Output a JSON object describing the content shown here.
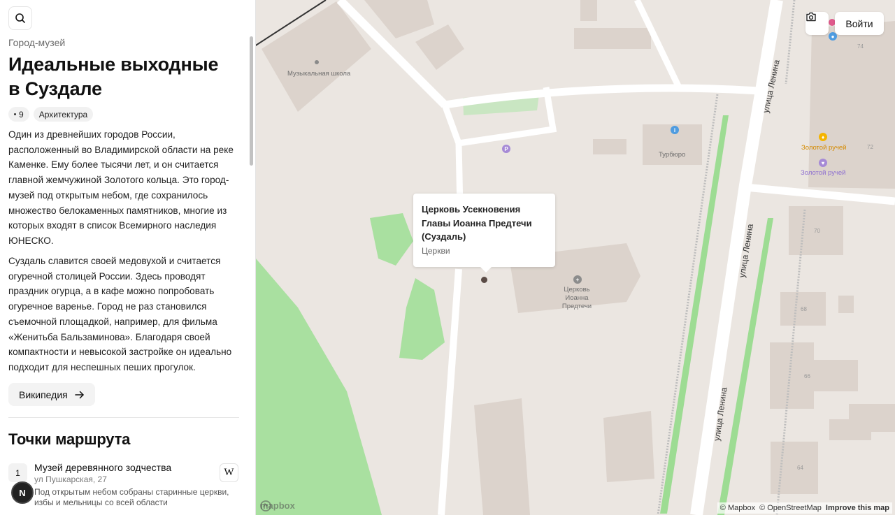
{
  "sidebar": {
    "eyebrow": "Город-музей",
    "title": "Идеальные выходные в Суздале",
    "chips": {
      "count": "9",
      "category": "Архитектура"
    },
    "paragraphs": [
      "Один из древнейших городов России, расположенный во Владимирской области на реке Каменке. Ему более тысячи лет, и он считается главной жемчужиной Золотого кольца. Это город-музей под открытым небом, где сохранилось множество белокаменных памятников, многие из которых входят в список Всемирного наследия ЮНЕСКО.",
      "Суздаль славится своей медовухой и считается огуречной столицей России. Здесь проводят праздник огурца, а в кафе можно попробовать огуречное варенье. Город не раз становился съемочной площадкой, например, для фильма «Женитьба Бальзаминова». Благодаря своей компактности и невысокой застройке он идеально подходит для неспешных пеших прогулок."
    ],
    "wiki_label": "Википедия",
    "section_title": "Точки маршрута",
    "route_items": [
      {
        "num": "1",
        "name": "Музей деревянного зодчества",
        "address": "ул Пушкарская, 27",
        "description": "Под открытым небом собраны старинные церкви, избы и мельницы со всей области",
        "wiki_glyph": "W"
      }
    ],
    "avatar_letter": "N"
  },
  "map": {
    "popup": {
      "title": "Церковь Усекновения Главы Иоанна Предтечи (Суздаль)",
      "subtitle": "Церкви"
    },
    "labels": {
      "music_school": "Музыкальная школа",
      "turburo": "Турбюро",
      "church": "Церковь Иоанна Предтечи",
      "golden_stream_1": "Золотой ручей",
      "golden_stream_2": "Золотой ручей",
      "street_1": "улица Ленина",
      "street_2": "улица Ленина",
      "street_3": "улица Ленина"
    },
    "house_numbers": [
      "74",
      "72",
      "70",
      "68",
      "66",
      "64"
    ],
    "poi_glyphs": {
      "parking": "P"
    },
    "login_label": "Войти",
    "attribution": {
      "mapbox": "© Mapbox",
      "osm": "© OpenStreetMap",
      "improve": "Improve this map"
    },
    "logo_text": "mapbox",
    "colors": {
      "land": "#ebe6e1",
      "building": "#dcd3cc",
      "park": "#a9e0a0",
      "road": "#ffffff",
      "parking_poi": "#a68ad6",
      "tourism_poi": "#4f9ce0",
      "food_poi": "#f4b400"
    }
  }
}
